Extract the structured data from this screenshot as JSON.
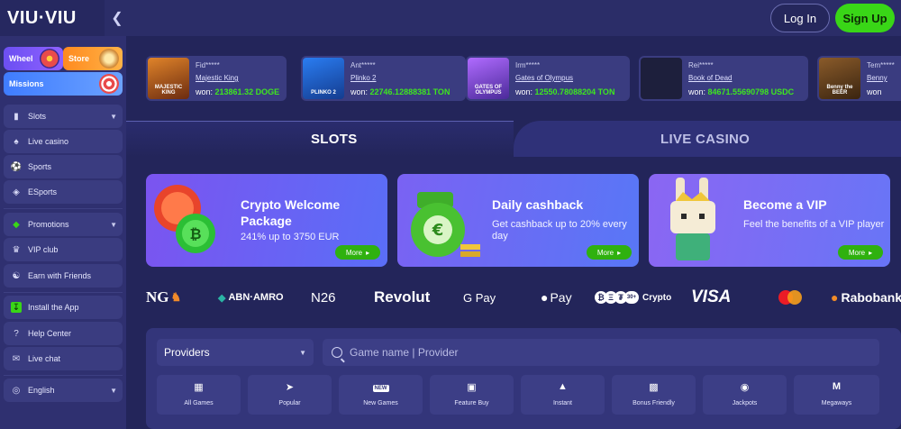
{
  "brand": {
    "logo": "VIU·VIU"
  },
  "header": {
    "collapse_icon": "chevron-left-icon",
    "login": "Log In",
    "signup": "Sign Up",
    "accent": "#39d617"
  },
  "sidebar": {
    "promos": [
      {
        "label": "Wheel"
      },
      {
        "label": "Store"
      },
      {
        "label": "Missions"
      }
    ],
    "items": [
      {
        "label": "Slots",
        "icon": "slot-icon",
        "chevron": true
      },
      {
        "label": "Live casino",
        "icon": "cards-icon"
      },
      {
        "label": "Sports",
        "icon": "ball-icon"
      },
      {
        "label": "ESports",
        "icon": "gamepad-icon"
      },
      {
        "label": "Promotions",
        "icon": "tag-icon",
        "chevron": true
      },
      {
        "label": "VIP club",
        "icon": "crown-icon"
      },
      {
        "label": "Earn with Friends",
        "icon": "handshake-icon"
      },
      {
        "label": "Install the App",
        "icon": "download-icon"
      },
      {
        "label": "Help Center",
        "icon": "help-icon"
      },
      {
        "label": "Live chat",
        "icon": "chat-icon"
      },
      {
        "label": "English",
        "icon": "globe-icon",
        "chevron": true
      }
    ]
  },
  "recent_wins": [
    {
      "user": "Fid*****",
      "game": "Majestic King",
      "won_label": "won:",
      "amount": "213861.32 DOGE",
      "thumb_text": "MAJESTIC KING"
    },
    {
      "user": "Ant*****",
      "game": "Plinko 2",
      "won_label": "won:",
      "amount": "22746.12888381 TON",
      "thumb_text": "PLINKO 2"
    },
    {
      "user": "Irm*****",
      "game": "Gates of Olympus",
      "won_label": "won:",
      "amount": "12550.78088204 TON",
      "thumb_text": "GATES OF OLYMPUS"
    },
    {
      "user": "Rei*****",
      "game": "Book of Dead",
      "won_label": "won:",
      "amount": "84671.55690798 USDC",
      "thumb_text": ""
    },
    {
      "user": "Tem*****",
      "game": "Benny",
      "won_label": "won",
      "amount": "",
      "thumb_text": "Benny the BEER"
    }
  ],
  "tabs": [
    {
      "label": "SLOTS",
      "active": true
    },
    {
      "label": "LIVE CASINO",
      "active": false
    }
  ],
  "banners": [
    {
      "title": "Crypto Welcome Package",
      "desc": "241% up to 3750 EUR",
      "more": "More"
    },
    {
      "title": "Daily cashback",
      "desc": "Get cashback up to  20% every day",
      "more": "More"
    },
    {
      "title": "Become a VIP",
      "desc": "Feel the benefits of a VIP player",
      "more": "More"
    }
  ],
  "payments": [
    "NG",
    "ABN·AMRO",
    "N26",
    "Revolut",
    "G Pay",
    "Pay",
    "Crypto",
    "VISA",
    "mastercard",
    "Rabobank"
  ],
  "providers": {
    "select_label": "Providers",
    "search_placeholder": "Game name | Provider",
    "categories": [
      {
        "label": "All Games",
        "icon": "grid-icon"
      },
      {
        "label": "Popular",
        "icon": "rocket-icon"
      },
      {
        "label": "New Games",
        "icon": "new-badge-icon"
      },
      {
        "label": "Feature Buy",
        "icon": "cart-icon"
      },
      {
        "label": "Instant",
        "icon": "flame-icon"
      },
      {
        "label": "Bonus Friendly",
        "icon": "gift-icon"
      },
      {
        "label": "Jackpots",
        "icon": "moneybag-icon"
      },
      {
        "label": "Megaways",
        "icon": "m-icon"
      }
    ]
  }
}
